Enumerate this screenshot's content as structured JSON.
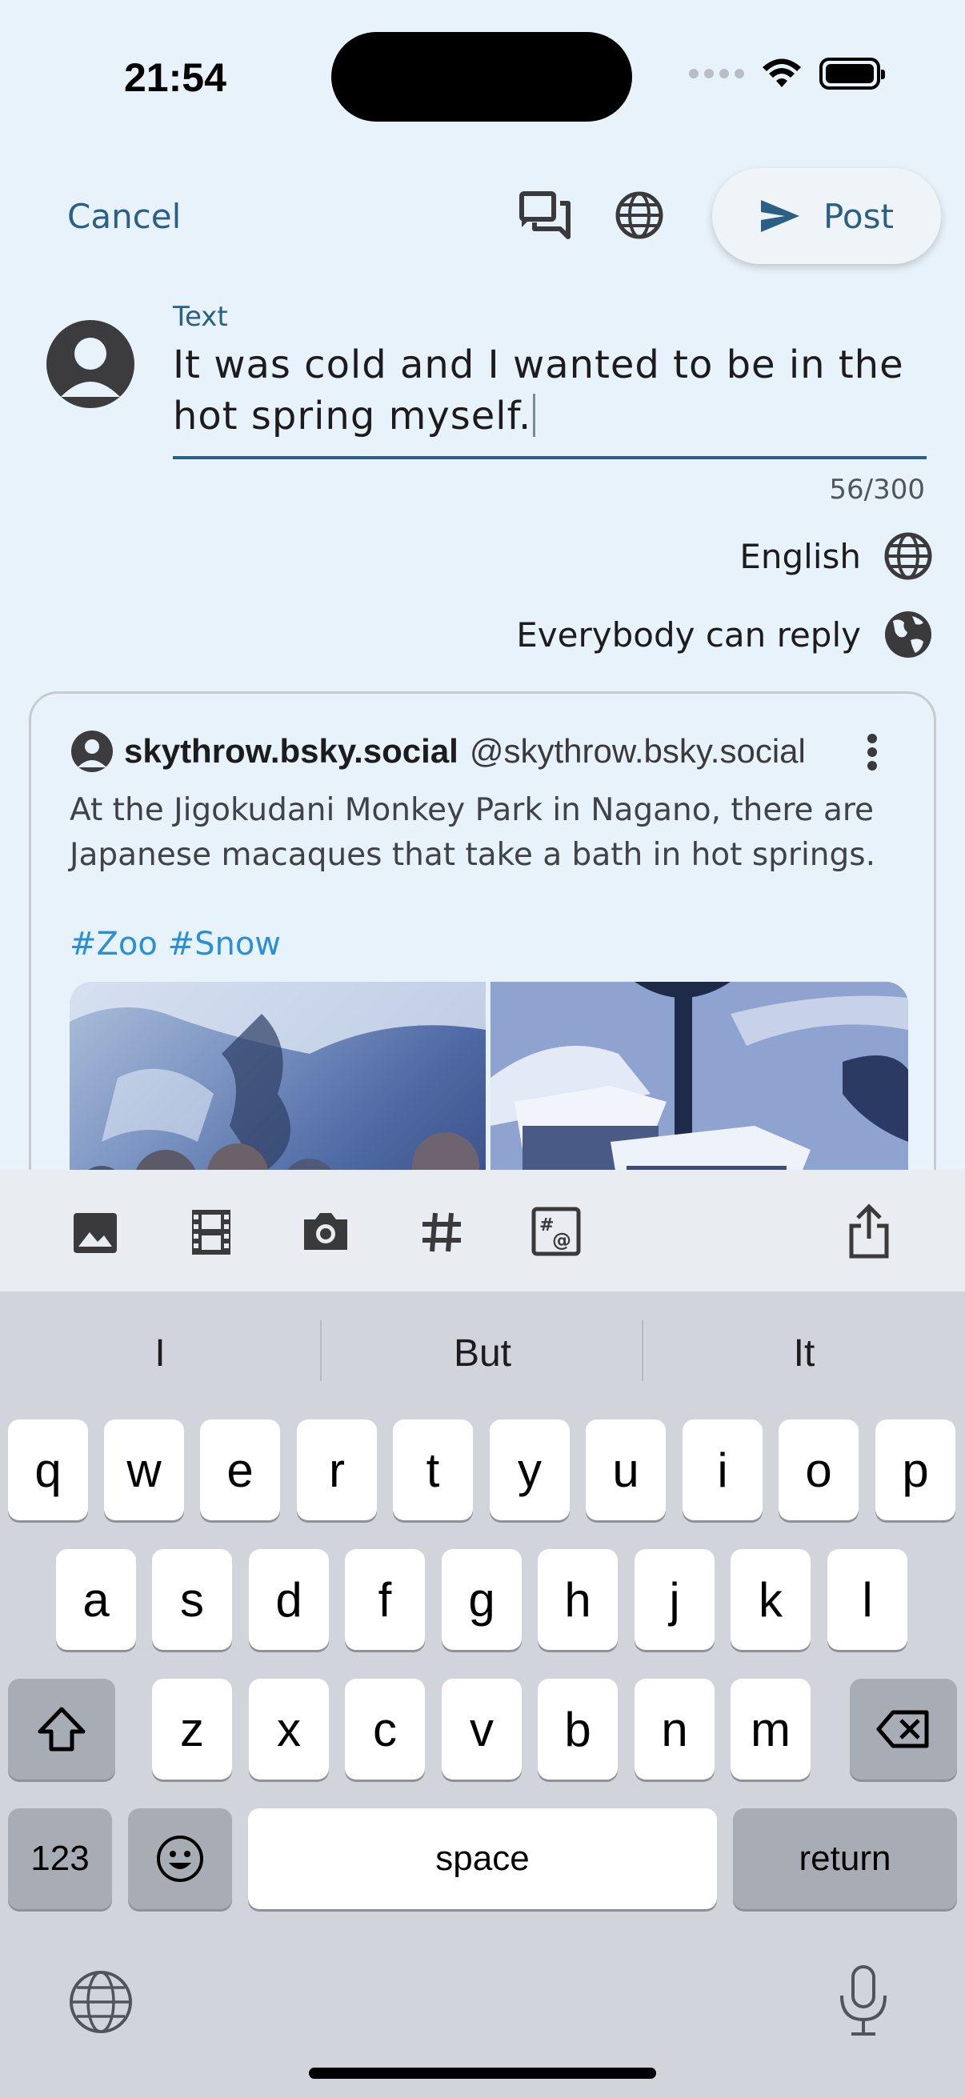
{
  "status_bar": {
    "time": "21:54"
  },
  "header": {
    "cancel_label": "Cancel",
    "post_label": "Post"
  },
  "compose": {
    "field_label": "Text",
    "text": "It was cold and I wanted to be in the hot spring myself.",
    "char_count": "56/300",
    "language": "English",
    "reply_setting": "Everybody can reply"
  },
  "quoted_post": {
    "display_name": "skythrow.bsky.social",
    "handle": "@skythrow.bsky.social",
    "text": "At the Jigokudani Monkey Park in Nagano, there are Japanese macaques that take a bath in hot springs.",
    "hashtags": "#Zoo #Snow"
  },
  "keyboard": {
    "suggestions": [
      "I",
      "But",
      "It"
    ],
    "row1": [
      "q",
      "w",
      "e",
      "r",
      "t",
      "y",
      "u",
      "i",
      "o",
      "p"
    ],
    "row2": [
      "a",
      "s",
      "d",
      "f",
      "g",
      "h",
      "j",
      "k",
      "l"
    ],
    "row3": [
      "z",
      "x",
      "c",
      "v",
      "b",
      "n",
      "m"
    ],
    "numbers_label": "123",
    "space_label": "space",
    "return_label": "return"
  },
  "colors": {
    "accent": "#2a5f86",
    "hashtag": "#2b8fd6",
    "background": "#e8f2fa"
  }
}
